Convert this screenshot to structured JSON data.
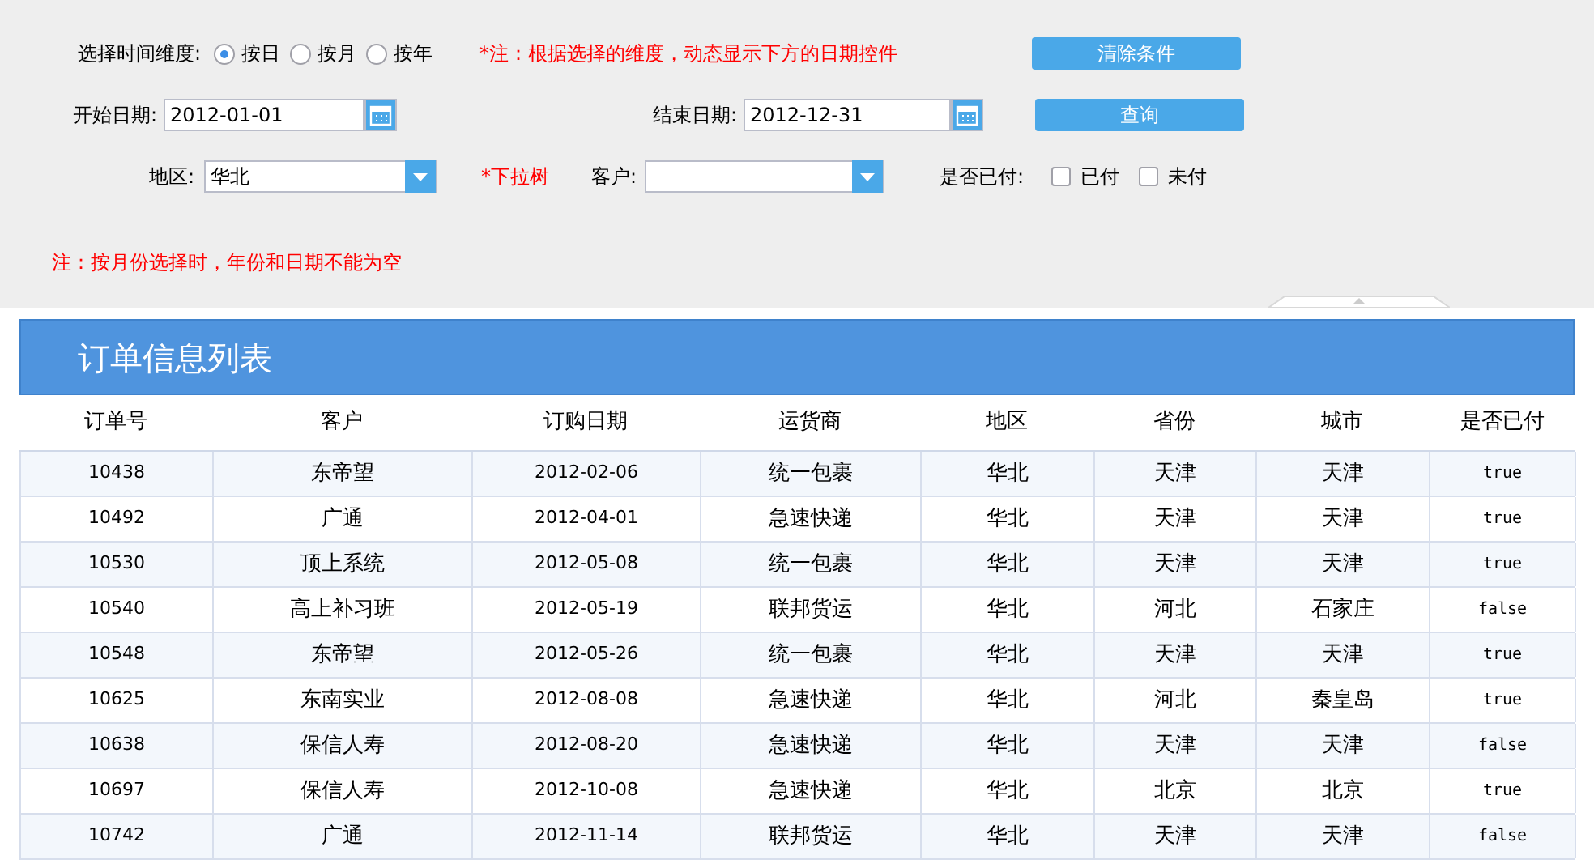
{
  "filters": {
    "dimension": {
      "label": "选择时间维度:",
      "options": [
        {
          "label": "按日",
          "selected": true
        },
        {
          "label": "按月",
          "selected": false
        },
        {
          "label": "按年",
          "selected": false
        }
      ],
      "note": "*注：根据选择的维度，动态显示下方的日期控件"
    },
    "start_date": {
      "label": "开始日期:",
      "value": "2012-01-01"
    },
    "end_date": {
      "label": "结束日期:",
      "value": "2012-12-31"
    },
    "region": {
      "label": "地区:",
      "value": "华北",
      "note": "*下拉树"
    },
    "customer": {
      "label": "客户:"
    },
    "paid": {
      "label": "是否已付:",
      "options": [
        {
          "label": "已付",
          "checked": false
        },
        {
          "label": "未付",
          "checked": false
        }
      ]
    },
    "buttons": [
      "清除条件",
      "查询"
    ],
    "note": "注：按月份选择时，年份和日期不能为空"
  },
  "table": {
    "title": "订单信息列表",
    "columns": [
      "订单号",
      "客户",
      "订购日期",
      "运货商",
      "地区",
      "省份",
      "城市",
      "是否已付"
    ],
    "rows": [
      [
        "10438",
        "东帝望",
        "2012-02-06",
        "统一包裹",
        "华北",
        "天津",
        "天津",
        "true"
      ],
      [
        "10492",
        "广通",
        "2012-04-01",
        "急速快递",
        "华北",
        "天津",
        "天津",
        "true"
      ],
      [
        "10530",
        "顶上系统",
        "2012-05-08",
        "统一包裹",
        "华北",
        "天津",
        "天津",
        "true"
      ],
      [
        "10540",
        "高上补习班",
        "2012-05-19",
        "联邦货运",
        "华北",
        "河北",
        "石家庄",
        "false"
      ],
      [
        "10548",
        "东帝望",
        "2012-05-26",
        "统一包裹",
        "华北",
        "天津",
        "天津",
        "true"
      ],
      [
        "10625",
        "东南实业",
        "2012-08-08",
        "急速快递",
        "华北",
        "河北",
        "秦皇岛",
        "true"
      ],
      [
        "10638",
        "保信人寿",
        "2012-08-20",
        "急速快递",
        "华北",
        "天津",
        "天津",
        "false"
      ],
      [
        "10697",
        "保信人寿",
        "2012-10-08",
        "急速快递",
        "华北",
        "北京",
        "北京",
        "true"
      ],
      [
        "10742",
        "广通",
        "2012-11-14",
        "联邦货运",
        "华北",
        "天津",
        "天津",
        "false"
      ]
    ]
  }
}
